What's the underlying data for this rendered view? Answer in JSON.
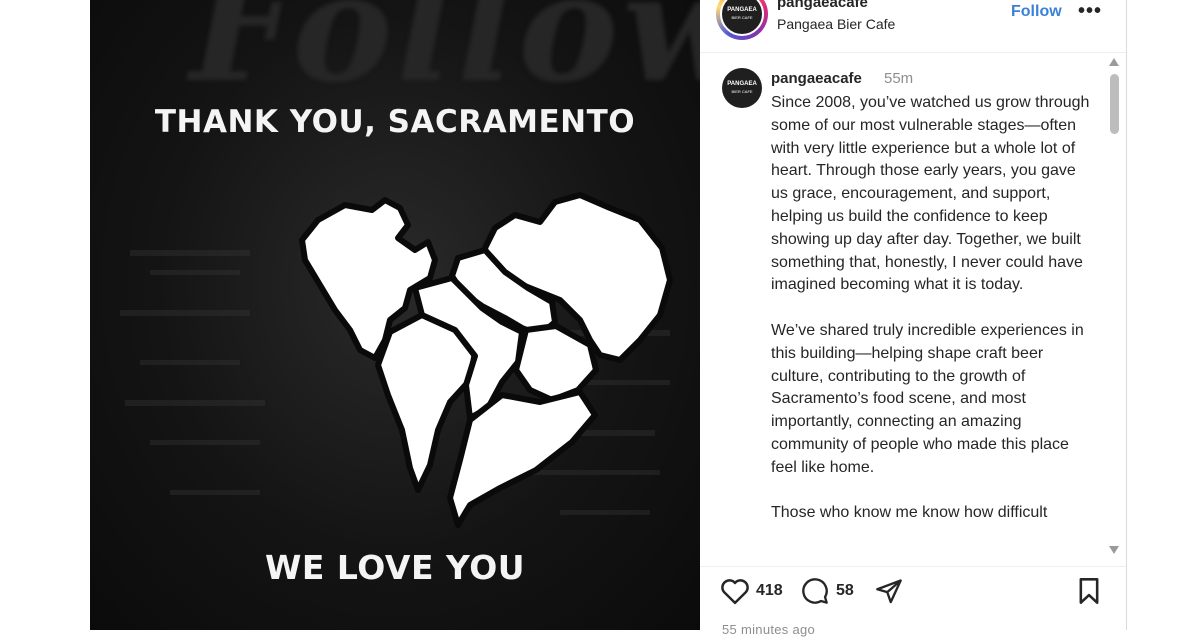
{
  "media": {
    "background_script_text": "Follow",
    "title": "THANK YOU, SACRAMENTO",
    "footer": "WE LOVE YOU"
  },
  "header": {
    "username": "pangaeacafe",
    "location": "Pangaea Bier Cafe",
    "follow_label": "Follow",
    "more_label": "•••",
    "avatar_text": "PANGAEA",
    "avatar_subtext": "BIER CAFE"
  },
  "post": {
    "username": "pangaeacafe",
    "time": "55m",
    "paragraphs": [
      "Since 2008, you’ve watched us grow through some of our most vulnerable stages—often with very little experience but a whole lot of heart. Through those early years, you gave us grace, encouragement, and support, helping us build the confidence to keep showing up day after day. Together, we built something that, honestly, I never could have imagined becoming what it is today.",
      "We’ve shared truly incredible experiences in this building—helping shape craft beer culture, contributing to the growth of Sacramento’s food scene, and most importantly, connecting an amazing community of people who made this place feel like home.",
      "Those who know me know how difficult"
    ]
  },
  "actions": {
    "likes": "418",
    "comments": "58",
    "posted_ago": "55 minutes ago"
  },
  "icons": {
    "like": "heart-icon",
    "comment": "comment-icon",
    "share": "share-icon",
    "save": "bookmark-icon",
    "more": "more-icon"
  },
  "colors": {
    "follow": "#3b82d6",
    "text": "#262626",
    "muted": "#8e8e8e",
    "media_bg": "#141414"
  }
}
